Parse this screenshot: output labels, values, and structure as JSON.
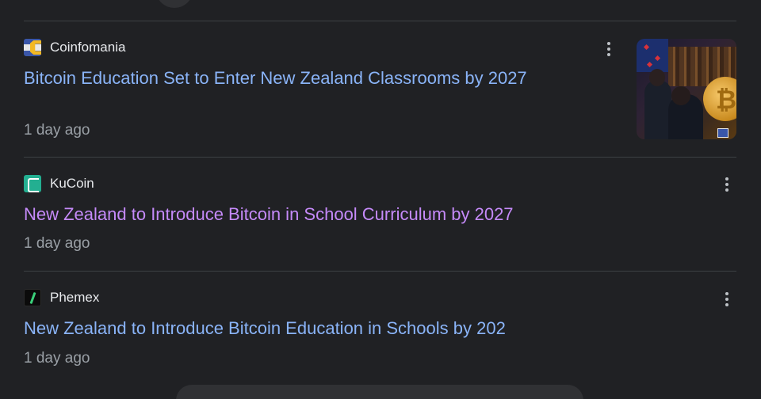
{
  "articles": [
    {
      "source": "Coinfomania",
      "logo_icon": "coinfomania-logo-icon",
      "headline": "Bitcoin Education Set to Enter New Zealand Classrooms by 2027",
      "headline_state": "unvisited",
      "time": "1 day ago",
      "has_thumbnail": true
    },
    {
      "source": "KuCoin",
      "logo_icon": "kucoin-logo-icon",
      "headline": "New Zealand to Introduce Bitcoin in School Curriculum by 2027",
      "headline_state": "visited",
      "time": "1 day ago",
      "has_thumbnail": false
    },
    {
      "source": "Phemex",
      "logo_icon": "phemex-logo-icon",
      "headline": "New Zealand to Introduce Bitcoin Education in Schools by 202",
      "headline_state": "unvisited",
      "time": "1 day ago",
      "has_thumbnail": false
    }
  ],
  "colors": {
    "background": "#202124",
    "link": "#8ab4f8",
    "visited_link": "#c58af9",
    "secondary_text": "#9aa0a6",
    "divider": "#3c4043"
  },
  "icons": {
    "more_options": "more-vert-icon"
  }
}
